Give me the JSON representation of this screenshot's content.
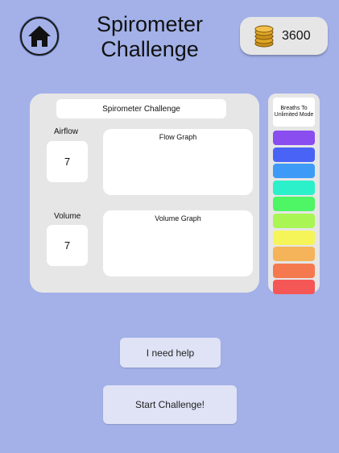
{
  "header": {
    "title_line1": "Spirometer",
    "title_line2": "Challenge",
    "coins": "3600"
  },
  "icons": {
    "home": "home-icon",
    "coins": "coin-stack-icon"
  },
  "panel": {
    "title": "Spirometer Challenge",
    "airflow_label": "Airflow",
    "airflow_value": "7",
    "volume_label": "Volume",
    "volume_value": "7",
    "flow_graph_label": "Flow Graph",
    "volume_graph_label": "Volume Graph"
  },
  "side": {
    "heading": "Breaths To Unlimited Mode",
    "bar_colors": [
      "#8a4df0",
      "#4a63f7",
      "#3d9bf7",
      "#2cf0c9",
      "#4ef564",
      "#a8f554",
      "#f5f55a",
      "#f5b45a",
      "#f5794f",
      "#f55656"
    ]
  },
  "buttons": {
    "help": "I need help",
    "start": "Start Challenge!"
  }
}
